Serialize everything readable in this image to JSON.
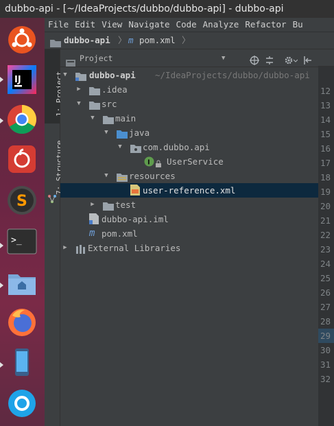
{
  "window": {
    "title": "dubbo-api - [~/IdeaProjects/dubbo/dubbo-api] - dubbo-api"
  },
  "launcher": {
    "items": [
      {
        "name": "ubuntu-dash-icon"
      },
      {
        "name": "intellij-idea-icon",
        "label": "IJ"
      },
      {
        "name": "chrome-icon"
      },
      {
        "name": "netease-music-icon"
      },
      {
        "name": "sublime-text-icon",
        "label": "S"
      },
      {
        "name": "terminal-icon",
        "label": ">_"
      },
      {
        "name": "files-icon"
      },
      {
        "name": "firefox-icon"
      },
      {
        "name": "phone-app-icon"
      },
      {
        "name": "circle-app-icon"
      }
    ]
  },
  "menu": [
    "File",
    "Edit",
    "View",
    "Navigate",
    "Code",
    "Analyze",
    "Refactor",
    "Bu"
  ],
  "breadcrumb": {
    "project": "dubbo-api",
    "file": "pom.xml"
  },
  "toolwindows": {
    "project_tab": "1: Project",
    "structure_tab": "7: Structure"
  },
  "panel": {
    "title": "Project"
  },
  "tree": {
    "root_name": "dubbo-api",
    "root_path": "~/IdeaProjects/dubbo/dubbo-api",
    "idea": ".idea",
    "src": "src",
    "main": "main",
    "java": "java",
    "package": "com.dubbo.api",
    "service": "UserService",
    "resources": "resources",
    "ref_xml": "user-reference.xml",
    "test": "test",
    "iml": "dubbo-api.iml",
    "pom": "pom.xml",
    "external": "External Libraries"
  },
  "gutter": {
    "tab": "29",
    "lines": [
      "12",
      "13",
      "14",
      "15",
      "16",
      "17",
      "18",
      "19",
      "20",
      "21",
      "22",
      "23",
      "24",
      "25",
      "26",
      "27",
      "28",
      "29",
      "30",
      "31",
      "32"
    ]
  }
}
